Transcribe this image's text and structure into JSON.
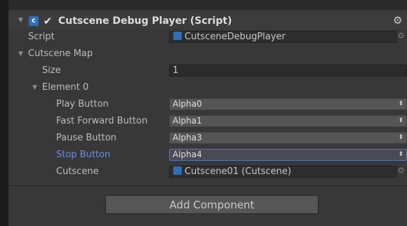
{
  "component": {
    "title": "Cutscene Debug Player (Script)",
    "enabled": true,
    "icons": {
      "fold": "triangle-down-icon",
      "script": "cs-script-icon",
      "settings": "gear-icon"
    }
  },
  "fields": {
    "script": {
      "label": "Script",
      "value": "CutsceneDebugPlayer"
    },
    "cutscene_map": {
      "label": "Cutscene Map"
    },
    "size": {
      "label": "Size",
      "value": "1"
    },
    "element0": {
      "label": "Element 0"
    },
    "play_button": {
      "label": "Play Button",
      "value": "Alpha0"
    },
    "fast_forward_button": {
      "label": "Fast Forward Button",
      "value": "Alpha1"
    },
    "pause_button": {
      "label": "Pause Button",
      "value": "Alpha3"
    },
    "stop_button": {
      "label": "Stop Button",
      "value": "Alpha4"
    },
    "cutscene": {
      "label": "Cutscene",
      "value": "Cutscene01 (Cutscene)"
    }
  },
  "glyphs": {
    "fold": "▼",
    "check": "✔",
    "gear": "⚙",
    "select_arrows": "⬍",
    "picker": "⊙",
    "script_icon": "c"
  },
  "add_component_label": "Add Component",
  "colors": {
    "panel": "#383838",
    "focus_label": "#6d8fe2",
    "selection_border": "#5b75b9"
  }
}
